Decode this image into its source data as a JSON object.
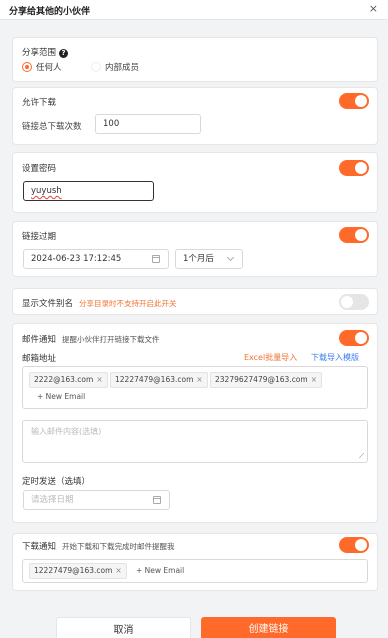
{
  "dialog": {
    "title": "分享给其他的小伙伴",
    "close_icon": "×"
  },
  "scope": {
    "label": "分享范围",
    "help_icon": "?",
    "options": [
      {
        "label": "任何人",
        "checked": true
      },
      {
        "label": "内部成员",
        "checked": false
      }
    ]
  },
  "download": {
    "label": "允许下载",
    "enabled": true,
    "limit_label": "链接总下载次数",
    "limit_value": "100"
  },
  "password": {
    "label": "设置密码",
    "enabled": true,
    "value": "yuyush"
  },
  "expiry": {
    "label": "链接过期",
    "enabled": true,
    "datetime": "2024-06-23 17:12:45",
    "duration": "1个月后"
  },
  "alias": {
    "label": "显示文件别名",
    "note": "分享目录时不支持开启此开关",
    "enabled": false
  },
  "email_notify": {
    "label": "邮件通知",
    "hint": "提醒小伙伴打开链接下载文件",
    "enabled": true,
    "address_label": "邮箱地址",
    "excel_import": "Excel批量导入",
    "download_template": "下载导入模版",
    "emails": [
      "2222@163.com",
      "12227479@163.com",
      "23279627479@163.com"
    ],
    "add_email": "+ New Email",
    "content_placeholder": "输入邮件内容(选填)",
    "schedule_label": "定时发送（选填）",
    "date_placeholder": "请选择日期"
  },
  "download_notify": {
    "label": "下载通知",
    "hint": "开始下载和下载完成时邮件提醒我",
    "enabled": true,
    "emails": [
      "12227479@163.com"
    ],
    "add_email": "+ New Email"
  },
  "footer": {
    "cancel": "取消",
    "create": "创建链接"
  },
  "colors": {
    "accent": "#ff6a2b",
    "link_blue": "#3a7ef2",
    "warning": "#f07330"
  }
}
